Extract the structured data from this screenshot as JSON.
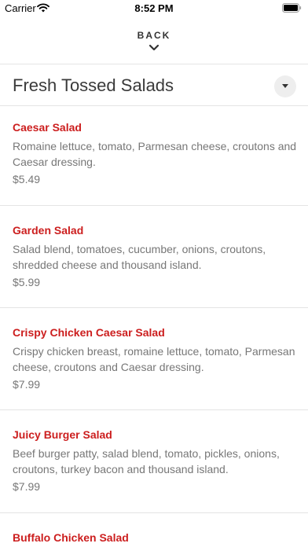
{
  "status_bar": {
    "carrier": "Carrier",
    "time": "8:52 PM"
  },
  "nav": {
    "back_label": "BACK"
  },
  "section": {
    "title": "Fresh Tossed Salads"
  },
  "items": [
    {
      "name": "Caesar Salad",
      "description": "Romaine lettuce, tomato, Parmesan cheese, croutons and Caesar dressing.",
      "price": "$5.49"
    },
    {
      "name": "Garden Salad",
      "description": "Salad blend, tomatoes, cucumber, onions, croutons, shredded cheese and thousand island.",
      "price": "$5.99"
    },
    {
      "name": "Crispy Chicken Caesar Salad",
      "description": "Crispy chicken breast, romaine lettuce, tomato, Parmesan cheese, croutons and Caesar dressing.",
      "price": "$7.99"
    },
    {
      "name": "Juicy Burger Salad",
      "description": "Beef burger patty, salad blend, tomato, pickles, onions, croutons, turkey bacon and thousand island.",
      "price": "$7.99"
    },
    {
      "name": "Buffalo Chicken Salad"
    }
  ],
  "colors": {
    "item_name": "#cc1e1e",
    "text_muted": "#777777",
    "divider": "#e4e4e4"
  },
  "icons": [
    "wifi-icon",
    "battery-icon",
    "chevron-down-icon",
    "caret-down-icon"
  ]
}
